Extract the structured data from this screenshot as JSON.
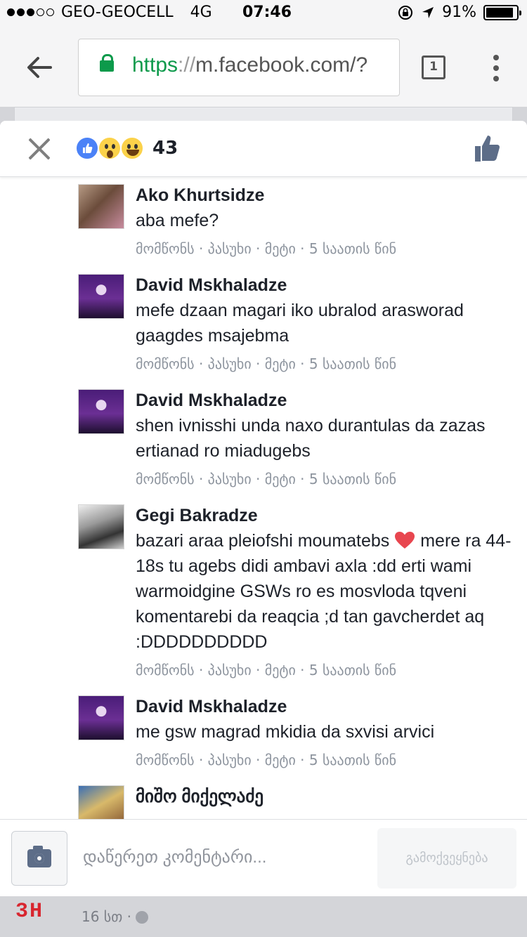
{
  "status_bar": {
    "carrier": "GEO-GEOCELL",
    "network": "4G",
    "time": "07:46",
    "battery": "91%",
    "battery_level": 0.91,
    "signal_bars_filled": 3,
    "signal_bars_total": 5
  },
  "browser": {
    "url_scheme": "https",
    "url_separator": "://",
    "url_host": "m.facebook.com/?",
    "tab_count": "1"
  },
  "reactions": {
    "count": "43",
    "types": [
      "like",
      "wow",
      "haha"
    ]
  },
  "comments": [
    {
      "author": "Ako Khurtsidze",
      "text": "aba mefe?",
      "meta": "მომწონს · პასუხი · მეტი · 5 საათის წინ"
    },
    {
      "author": "David Mskhaladze",
      "text": "mefe dzaan magari iko ubralod araswo­rad gaagdes msajebma",
      "meta": "მომწონს · პასუხი · მეტი · 5 საათის წინ"
    },
    {
      "author": "David Mskhaladze",
      "text": "shen ivnisshi unda naxo durantulas da zazas ertianad ro miadugebs",
      "meta": "მომწონს · პასუხი · მეტი · 5 საათის წინ"
    },
    {
      "author": "Gegi Bakradze",
      "text_before_icon": "bazari araa pleiofshi moumatebs",
      "text_after_icon": "mere ra 44-18s tu agebs didi ambavi axla :dd erti wami warmoidgine GSWs ro es mosvloda tqveni komentarebi da reaqcia ;d tan gavcherdet aq :DDDDDDDDDD",
      "meta": "მომწონს · პასუხი · მეტი · 5 საათის წინ"
    },
    {
      "author": "David Mskhaladze",
      "text": "me gsw magrad mkidia da sxvisi arvici",
      "meta": "მომწონს · პასუხი · მეტი · 5 საათის წინ"
    },
    {
      "author": "მიშო მიქელაძე",
      "text": "",
      "meta": ""
    }
  ],
  "composer": {
    "placeholder": "დაწერეთ კომენტარი...",
    "send_label": "გამოქვეყნება"
  },
  "background": {
    "logo": "3H",
    "time": "16 სთ ·"
  },
  "colors": {
    "secure_green": "#0d9a4b",
    "like_blue": "#4b82f7",
    "text_dark": "#1d2129",
    "meta_gray": "#8d949e"
  }
}
